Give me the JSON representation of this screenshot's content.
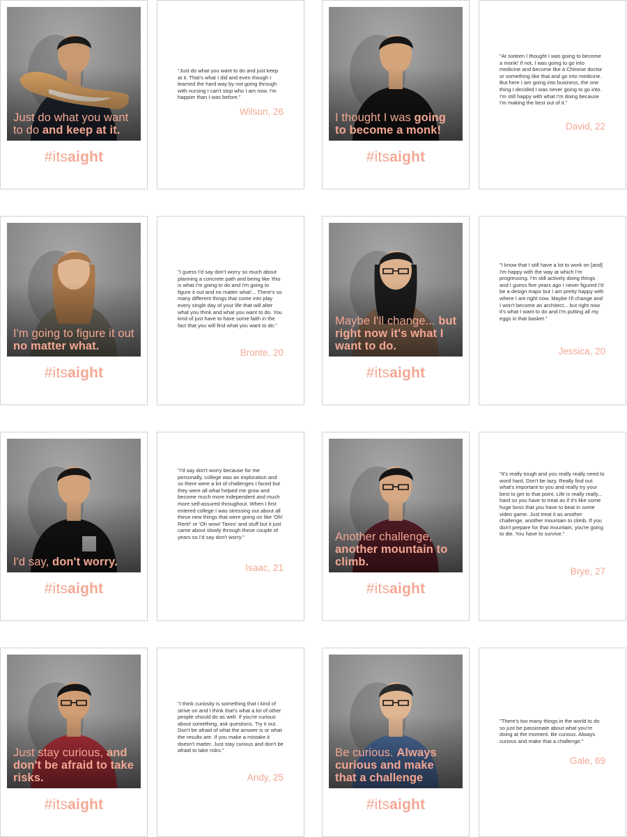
{
  "profiles": [
    {
      "caption_light": "Just do what you want to do ",
      "caption_bold": "and keep at it.",
      "hashtag_light": "#its",
      "hashtag_bold": "aight",
      "quote": "\"Just do what you want to do and just keep at it. That's what I did and even though I learned the hard way by not going through with nursing I can't stop who I am now. I'm happier than I was before.\"",
      "author": "Wilson, 26",
      "shirt_color": "#1f2630",
      "skin_color": "#c99a72",
      "hair_color": "#1a1a1a"
    },
    {
      "caption_light": "I thought I was ",
      "caption_bold": "going to become a monk!",
      "hashtag_light": "#its",
      "hashtag_bold": "aight",
      "quote": "\"At sixteen I thought I was going to become a monk! If not, I was going to go into medicine and become like a Chinese doctor or something like that and go into medicine. But here I am going into business, the one thing I decided I was never going to go into. I'm still happy with what I'm doing because I'm making the best out of it.\"",
      "author": "David, 22",
      "shirt_color": "#151515",
      "skin_color": "#d4a47b",
      "hair_color": "#151515"
    },
    {
      "caption_light": "I'm going to figure it out ",
      "caption_bold": "no matter what.",
      "hashtag_light": "#its",
      "hashtag_bold": "aight",
      "quote": "\"I guess I'd say don't worry so much about planning a concrete path and being like 'this is what I'm going to do and I'm going to figure it out and no matter what'... There's so many different things that come into play every single day of your life that will alter what you think and what you want to do. You kind of just have to have some faith in the fact that you will find what you want to do.\"",
      "author": "Bronte, 20",
      "shirt_color": "#6e6a5e",
      "skin_color": "#e0b592",
      "hair_color": "#a8774a"
    },
    {
      "caption_light": "Maybe I'll change... ",
      "caption_bold": "but right now it's what I want to do.",
      "hashtag_light": "#its",
      "hashtag_bold": "aight",
      "quote": "\"I know that I still have a lot to work on [and] I'm happy with the way at which I'm progressing. I'm still actively doing things and I guess five years ago I never figured I'd be a design major but I am pretty happy with where I am right now. Maybe I'll change and I won't become an architect... but right now it's what I want to do and I'm putting all my eggs in that basket.\"",
      "author": "Jessica, 20",
      "shirt_color": "#8a6a52",
      "skin_color": "#dcb28f",
      "hair_color": "#1b1b1b"
    },
    {
      "caption_light": "I'd say, ",
      "caption_bold": "don't worry.",
      "hashtag_light": "#its",
      "hashtag_bold": "aight",
      "quote": "\"I'd say don't worry because for me personally, college was an exploration and so there were a lot of challenges I faced but they were all what helped me grow and become much more independent and much more self-assured throughout. When I first entered college I was stressing out about all these new things that were going on like 'Oh! Rent!' or 'Oh wow! Taxes' and stuff but it just came about slowly through these couple of years so I'd say don't worry.\"",
      "author": "Isaac, 21",
      "shirt_color": "#141414",
      "skin_color": "#d2a27a",
      "hair_color": "#161616"
    },
    {
      "caption_light": "Another challenge, ",
      "caption_bold": "another mountain to climb.",
      "hashtag_light": "#its",
      "hashtag_bold": "aight",
      "quote": "\"It's really tough and you really really need to word hard. Don't be lazy. Really find out what's important to you and really try your best to get to that point. Life is really really... hard so you have to treat as if it's like some huge boss that you have to beat in some video game. Just treat it as another challenge, another mountain to climb. If you don't prepare for that mountain, you're going to die. You have to survive.\"",
      "author": "Brye, 27",
      "shirt_color": "#5e1f2a",
      "skin_color": "#d6a883",
      "hair_color": "#151515"
    },
    {
      "caption_light": "Just stay curious, ",
      "caption_bold": "and don't be afraid to take risks.",
      "hashtag_light": "#its",
      "hashtag_bold": "aight",
      "quote": "\"I think curiosity is something that I kind of strive on and I think that's what a lot of other people should do as well. If you're curious about something, ask questions. Try it out. Don't be afraid of what the answer is or what the results are. If you make a mistake it doesn't matter. Just stay curious and don't be afraid to take risks.\"",
      "author": "Andy, 25",
      "shirt_color": "#b0303a",
      "skin_color": "#cf9c73",
      "hair_color": "#151515"
    },
    {
      "caption_light": "Be curious. ",
      "caption_bold": "Always curious and make that a challenge",
      "hashtag_light": "#its",
      "hashtag_bold": "aight",
      "quote": "\"There's too many things in the world to do so just be passionate about what you're doing at the moment. Be curious. Always curious and make that a challenge.\"",
      "author": "Gale, 69",
      "shirt_color": "#4b6a9a",
      "skin_color": "#e0b592",
      "hair_color": "#2a2a2a"
    }
  ]
}
